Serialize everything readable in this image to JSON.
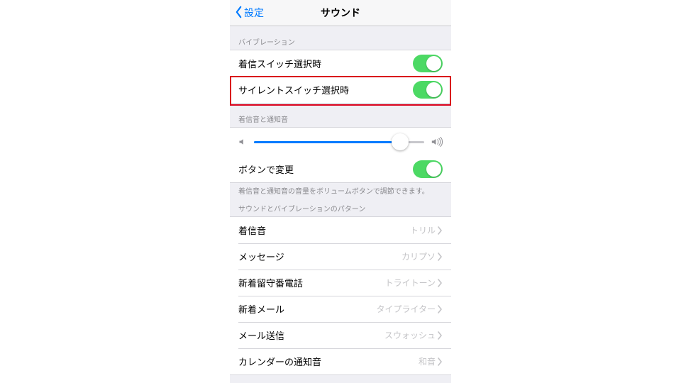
{
  "nav": {
    "back": "設定",
    "title": "サウンド"
  },
  "sections": {
    "vibration_header": "バイブレーション",
    "ringer_label": "着信スイッチ選択時",
    "silent_label": "サイレントスイッチ選択時",
    "ringtones_header": "着信音と通知音",
    "button_change_label": "ボタンで変更",
    "button_change_footer": "着信音と通知音の音量をボリュームボタンで調節できます。",
    "patterns_header": "サウンドとバイブレーションのパターン"
  },
  "slider": {
    "value_pct": 86
  },
  "toggles": {
    "ringer": true,
    "silent": true,
    "button_change": true
  },
  "rows": [
    {
      "label": "着信音",
      "value": "トリル"
    },
    {
      "label": "メッセージ",
      "value": "カリプソ"
    },
    {
      "label": "新着留守番電話",
      "value": "トライトーン"
    },
    {
      "label": "新着メール",
      "value": "タイプライター"
    },
    {
      "label": "メール送信",
      "value": "スウォッシュ"
    },
    {
      "label": "カレンダーの通知音",
      "value": "和音"
    }
  ],
  "highlight_row_index": 1
}
